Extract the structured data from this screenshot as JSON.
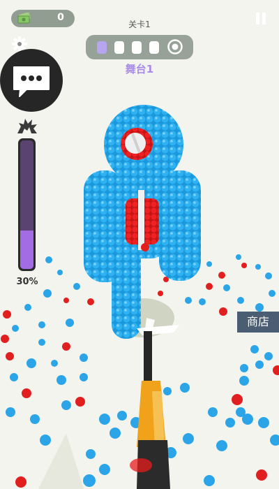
{
  "hud": {
    "cash_value": "0",
    "level_title": "关卡1",
    "stage_label": "舞台1",
    "stage_progress": {
      "total_steps": 4,
      "current_step": 1
    },
    "power_percent_label": "30%",
    "power_fraction": 0.3,
    "shop_label": "商店"
  },
  "icons": {
    "cash": "cash-icon",
    "pause": "pause-icon",
    "settings": "gear-icon",
    "chat": "chat-bubble-icon",
    "rage": "explosion-icon",
    "stage_goal": "target-icon"
  },
  "colors": {
    "enemy_blue": "#22a6ea",
    "enemy_core_red": "#e81c1c",
    "power_fill": "#a46ce4",
    "stage_label": "#a88be8",
    "gun_orange": "#f0a21b",
    "shop_bg": "#4b5d72"
  }
}
